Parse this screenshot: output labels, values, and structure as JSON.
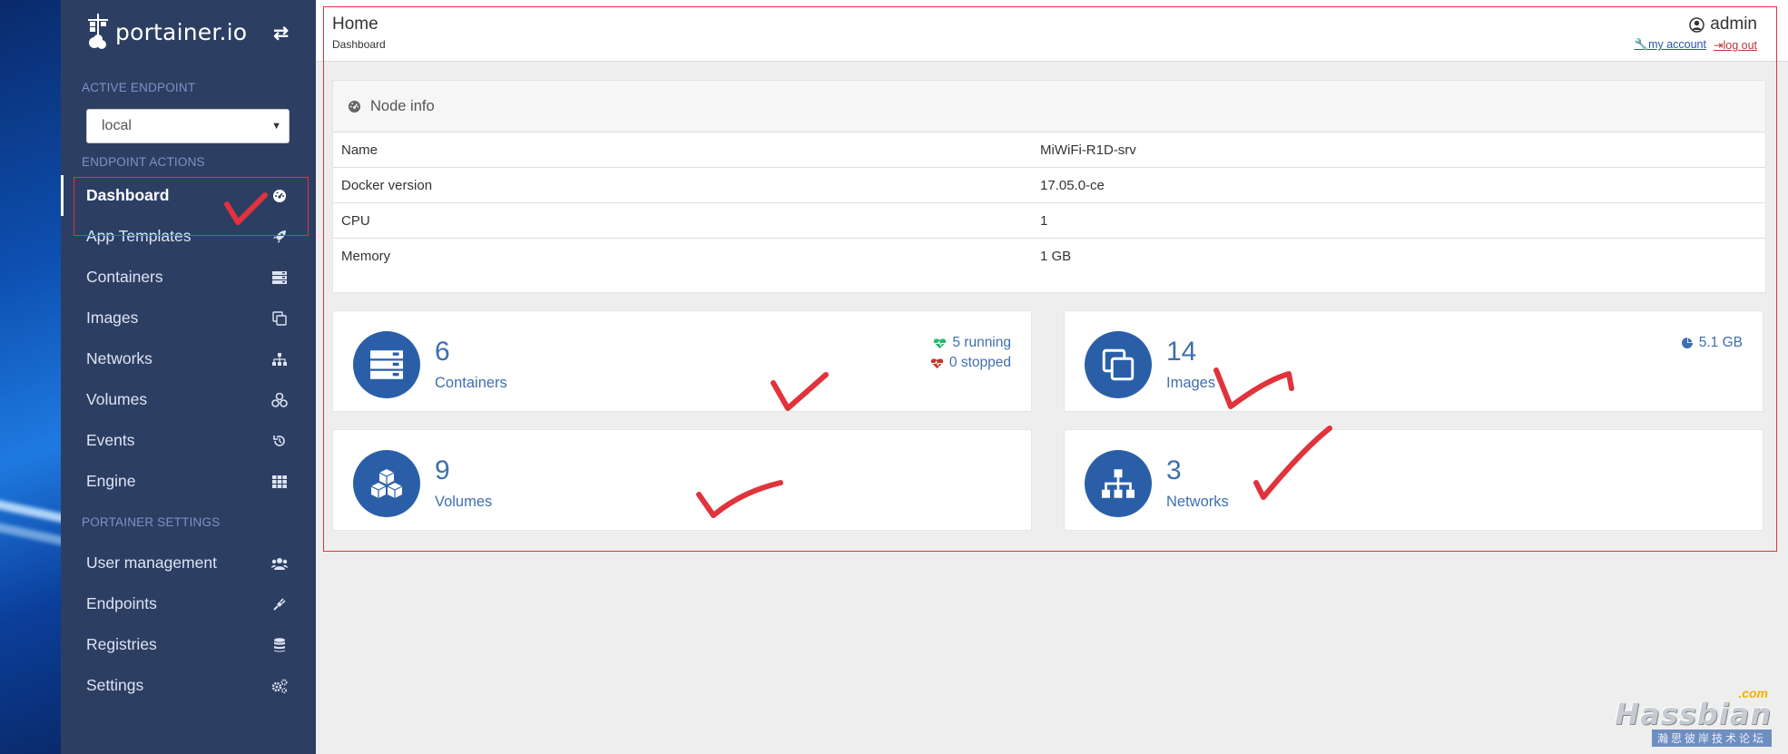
{
  "brand": {
    "name": "portainer.io",
    "toggle_icon": "exchange-icon"
  },
  "sidebar": {
    "active_endpoint_title": "ACTIVE ENDPOINT",
    "endpoint_value": "local",
    "endpoint_actions_title": "ENDPOINT ACTIONS",
    "items": [
      {
        "label": "Dashboard",
        "icon": "tachometer-icon"
      },
      {
        "label": "App Templates",
        "icon": "rocket-icon"
      },
      {
        "label": "Containers",
        "icon": "server-icon"
      },
      {
        "label": "Images",
        "icon": "clone-icon"
      },
      {
        "label": "Networks",
        "icon": "sitemap-icon"
      },
      {
        "label": "Volumes",
        "icon": "cubes-icon"
      },
      {
        "label": "Events",
        "icon": "history-icon"
      },
      {
        "label": "Engine",
        "icon": "th-icon"
      }
    ],
    "settings_title": "PORTAINER SETTINGS",
    "settings_items": [
      {
        "label": "User management",
        "icon": "users-icon"
      },
      {
        "label": "Endpoints",
        "icon": "plug-icon"
      },
      {
        "label": "Registries",
        "icon": "database-icon"
      },
      {
        "label": "Settings",
        "icon": "cogs-icon"
      }
    ]
  },
  "header": {
    "title": "Home",
    "breadcrumb": "Dashboard",
    "user": "admin",
    "my_account": "my account",
    "logout": "log out"
  },
  "node_info": {
    "title": "Node info",
    "rows": [
      {
        "key": "Name",
        "value": "MiWiFi-R1D-srv"
      },
      {
        "key": "Docker version",
        "value": "17.05.0-ce"
      },
      {
        "key": "CPU",
        "value": "1"
      },
      {
        "key": "Memory",
        "value": "1 GB"
      }
    ]
  },
  "widgets": {
    "containers": {
      "count": "6",
      "label": "Containers",
      "running": "5 running",
      "stopped": "0 stopped"
    },
    "images": {
      "count": "14",
      "label": "Images",
      "size": "5.1 GB"
    },
    "volumes": {
      "count": "9",
      "label": "Volumes"
    },
    "networks": {
      "count": "3",
      "label": "Networks"
    }
  },
  "watermark": {
    "com": ".com",
    "name": "Hassbian",
    "subtitle": "瀚思彼岸技术论坛"
  },
  "colors": {
    "sidebar": "#2d3e63",
    "accent": "#2a5fa8",
    "annotation": "#e0333b"
  }
}
